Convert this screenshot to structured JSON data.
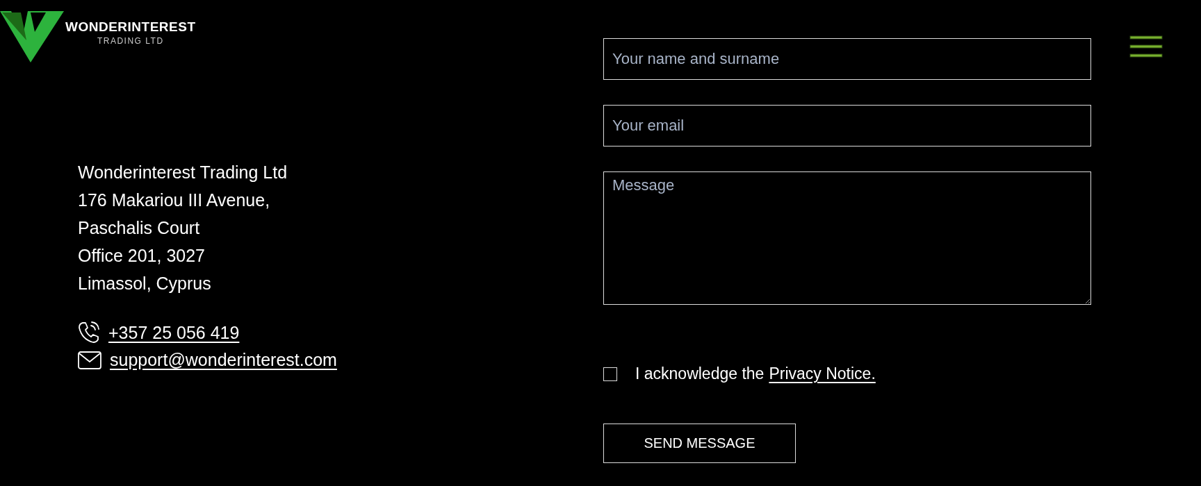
{
  "logo": {
    "name": "WONDERINTEREST",
    "subtitle": "TRADING LTD"
  },
  "address": [
    "Wonderinterest Trading Ltd",
    "176 Makariou III Avenue,",
    "Paschalis Court",
    "Office 201, 3027",
    "Limassol, Cyprus"
  ],
  "contacts": [
    {
      "kind": "phone",
      "text": "+357 25 056 419"
    },
    {
      "kind": "email",
      "text": "support@wonderinterest.com"
    }
  ],
  "form": {
    "fields": [
      {
        "kind": "input",
        "placeholder": "Your name and surname"
      },
      {
        "kind": "input",
        "placeholder": "Your email"
      },
      {
        "kind": "textarea",
        "placeholder": "Message"
      }
    ],
    "consent": {
      "checked": false,
      "text": "I acknowledge the",
      "link": "Privacy Notice."
    },
    "submit": "SEND MESSAGE"
  }
}
